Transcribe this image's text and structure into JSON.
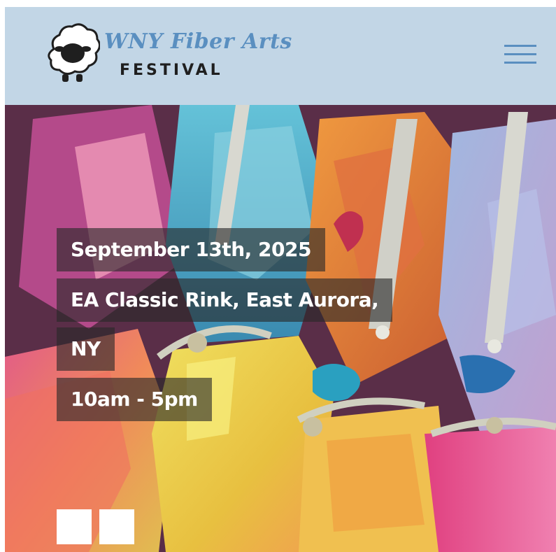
{
  "header": {
    "logo": {
      "script_text": "WNY Fiber Arts",
      "sub_text": "FESTIVAL"
    },
    "menu_icon": "hamburger-menu-icon"
  },
  "hero": {
    "event": {
      "date": "September 13th, 2025",
      "location_line1": "EA Classic Rink, East Aurora,",
      "location_line2": "NY",
      "hours": "10am - 5pm"
    },
    "slider": {
      "dot_count": 2
    }
  },
  "colors": {
    "header_bg": "#c2d6e6",
    "accent_blue": "#5a8fc0",
    "overlay": "rgba(40,40,40,0.62)"
  }
}
